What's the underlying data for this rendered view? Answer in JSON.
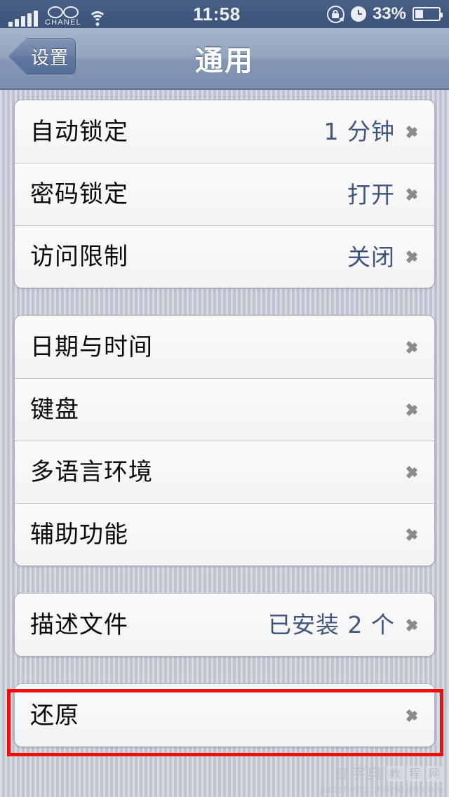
{
  "status_bar": {
    "carrier": "CHANEL",
    "carrier_logo_icon": "chanel-logo-icon",
    "signal_icon": "signal-bars-icon",
    "signal_bars_total": 5,
    "signal_bars_filled": 5,
    "wifi_icon": "wifi-icon",
    "time": "11:58",
    "rotation_lock_icon": "rotation-lock-icon",
    "alarm_icon": "alarm-clock-icon",
    "battery_percent": "33%",
    "battery_level": 33,
    "battery_icon": "battery-icon"
  },
  "nav_bar": {
    "back_label": "设置",
    "back_icon": "chevron-left-icon",
    "title": "通用"
  },
  "groups": [
    {
      "name": "lock-settings-group",
      "rows": [
        {
          "label": "自动锁定",
          "value": "1 分钟",
          "chevron_icon": "chevron-right-icon"
        },
        {
          "label": "密码锁定",
          "value": "打开",
          "chevron_icon": "chevron-right-icon"
        },
        {
          "label": "访问限制",
          "value": "关闭",
          "chevron_icon": "chevron-right-icon"
        }
      ]
    },
    {
      "name": "system-settings-group",
      "rows": [
        {
          "label": "日期与时间",
          "value": "",
          "chevron_icon": "chevron-right-icon"
        },
        {
          "label": "键盘",
          "value": "",
          "chevron_icon": "chevron-right-icon"
        },
        {
          "label": "多语言环境",
          "value": "",
          "chevron_icon": "chevron-right-icon"
        },
        {
          "label": "辅助功能",
          "value": "",
          "chevron_icon": "chevron-right-icon"
        }
      ]
    },
    {
      "name": "profiles-group",
      "rows": [
        {
          "label": "描述文件",
          "value": "已安装 2 个",
          "chevron_icon": "chevron-right-icon"
        }
      ]
    },
    {
      "name": "reset-group",
      "rows": [
        {
          "label": "还原",
          "value": "",
          "chevron_icon": "chevron-right-icon"
        }
      ]
    }
  ],
  "annotation": {
    "highlight_target": "还原",
    "highlight_color": "#ef0e0e"
  },
  "watermark": {
    "brand": "查字典",
    "boxed": [
      "教",
      "程",
      "网"
    ],
    "url": "jiaocheng.chazidian.com"
  },
  "colors": {
    "nav_bar_title": "#ffffff",
    "row_value_blue": "#41557d",
    "chevron_gray": "#8b8b8b",
    "background": "#c9ccd7",
    "highlight_red": "#ef0e0e"
  }
}
